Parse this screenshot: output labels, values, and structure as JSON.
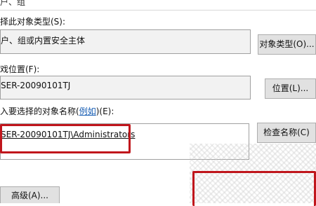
{
  "window": {
    "title": "户、组"
  },
  "object_type": {
    "label": "择此对象类型(S):",
    "value": "户、组或内置安全主体",
    "button": "对象类型(O)..."
  },
  "location": {
    "label": "戏位置(F):",
    "value": "SER-20090101TJ",
    "button": "位置(L)..."
  },
  "names": {
    "label_prefix": "入要选择的对象名称(",
    "label_link": "例如",
    "label_suffix": ")(E):",
    "value": "SER-20090101TJ\\Administrators",
    "button": "检查名称(C)"
  },
  "footer": {
    "advanced_button": "高级(A)..."
  },
  "colors": {
    "highlight": "#c0161c",
    "link": "#1a5fb4"
  }
}
